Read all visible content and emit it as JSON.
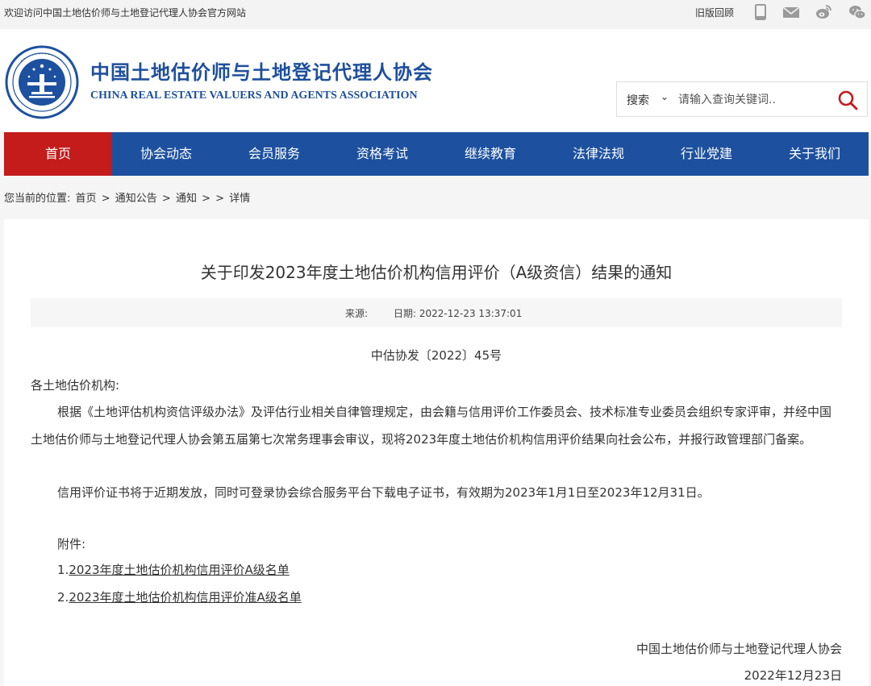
{
  "topbar": {
    "welcome": "欢迎访问中国土地估价师与土地登记代理人协会官方网站",
    "old_version": "旧版回顾",
    "icons": [
      "mobile-icon",
      "mail-icon",
      "weibo-icon",
      "wechat-icon"
    ]
  },
  "header": {
    "org_name_cn": "中国土地估价师与土地登记代理人协会",
    "org_name_en": "CHINA REAL ESTATE VALUERS AND AGENTS ASSOCIATION",
    "brand_color": "#1d519f",
    "accent_color": "#c41b1b"
  },
  "search": {
    "scope": "搜索",
    "placeholder": "请输入查询关键词.."
  },
  "nav": {
    "items": [
      "首页",
      "协会动态",
      "会员服务",
      "资格考试",
      "继续教育",
      "法律法规",
      "行业党建",
      "关于我们"
    ],
    "active_index": 0
  },
  "breadcrumb": {
    "prefix": "您当前的位置:",
    "items": [
      "首页",
      "通知公告",
      "通知",
      "",
      "详情"
    ],
    "separator": ">"
  },
  "article": {
    "title": "关于印发2023年度土地估价机构信用评价（A级资信）结果的通知",
    "source_label": "来源:",
    "source_value": "",
    "date_label": "日期:",
    "date_value": "2022-12-23 13:37:01",
    "doc_no": "中估协发〔2022〕45号",
    "greeting": "各土地估价机构:",
    "para1": "根据《土地评估机构资信评级办法》及评估行业相关自律管理规定，由会籍与信用评价工作委员会、技术标准专业委员会组织专家评审，并经中国土地估价师与土地登记代理人协会第五届第七次常务理事会审议，现将2023年度土地估价机构信用评价结果向社会公布，并报行政管理部门备案。",
    "para2": "信用评价证书将于近期发放，同时可登录协会综合服务平台下载电子证书，有效期为2023年1月1日至2023年12月31日。",
    "attachment_heading": "附件:",
    "attachments": [
      {
        "prefix": "1.",
        "label": "2023年度土地估价机构信用评价A级名单"
      },
      {
        "prefix": "2.",
        "label": "2023年度土地估价机构信用评价准A级名单"
      }
    ],
    "signature_org": "中国土地估价师与土地登记代理人协会",
    "signature_date": "2022年12月23日"
  }
}
